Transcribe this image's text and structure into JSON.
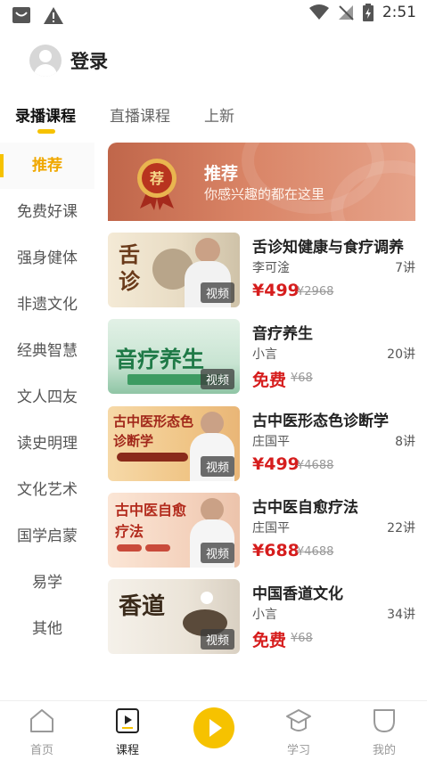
{
  "status": {
    "time": "2:51"
  },
  "header": {
    "login_label": "登录"
  },
  "tabs": [
    {
      "label": "录播课程",
      "active": true
    },
    {
      "label": "直播课程",
      "active": false
    },
    {
      "label": "上新",
      "active": false
    }
  ],
  "sidebar": {
    "items": [
      {
        "label": "推荐",
        "active": true
      },
      {
        "label": "免费好课"
      },
      {
        "label": "强身健体"
      },
      {
        "label": "非遗文化"
      },
      {
        "label": "经典智慧"
      },
      {
        "label": "文人四友"
      },
      {
        "label": "读史明理"
      },
      {
        "label": "文化艺术"
      },
      {
        "label": "国学启蒙"
      },
      {
        "label": "易学"
      },
      {
        "label": "其他"
      }
    ]
  },
  "banner": {
    "badge_char": "荐",
    "title": "推荐",
    "subtitle": "你感兴趣的都在这里"
  },
  "courses": [
    {
      "title": "舌诊知健康与食疗调养",
      "teacher": "李可淦",
      "lessons": "7讲",
      "price": "¥499",
      "original_price": "¥2968",
      "tag": "视频",
      "thumb_text": "舌诊"
    },
    {
      "title": "音疗养生",
      "teacher": "小言",
      "lessons": "20讲",
      "price": "免费",
      "original_price": "¥68",
      "tag": "视频",
      "thumb_text": "音疗养生"
    },
    {
      "title": "古中医形态色诊断学",
      "teacher": "庄国平",
      "lessons": "8讲",
      "price": "¥499",
      "original_price": "¥4688",
      "tag": "视频",
      "thumb_text": "古中医形态色诊断学"
    },
    {
      "title": "古中医自愈疗法",
      "teacher": "庄国平",
      "lessons": "22讲",
      "price": "¥688",
      "original_price": "¥4688",
      "tag": "视频",
      "thumb_text": "古中医自愈疗法"
    },
    {
      "title": "中国香道文化",
      "teacher": "小言",
      "lessons": "34讲",
      "price": "免费",
      "original_price": "¥68",
      "tag": "视频",
      "thumb_text": "香道"
    }
  ],
  "bottom_nav": [
    {
      "label": "首页",
      "icon": "home-icon"
    },
    {
      "label": "课程",
      "icon": "course-icon",
      "active": true
    },
    {
      "label": "",
      "icon": "play-icon"
    },
    {
      "label": "学习",
      "icon": "study-icon"
    },
    {
      "label": "我的",
      "icon": "profile-icon"
    }
  ],
  "colors": {
    "accent": "#f6c200",
    "price_red": "#d61d1d",
    "banner": "#c86a4e"
  }
}
